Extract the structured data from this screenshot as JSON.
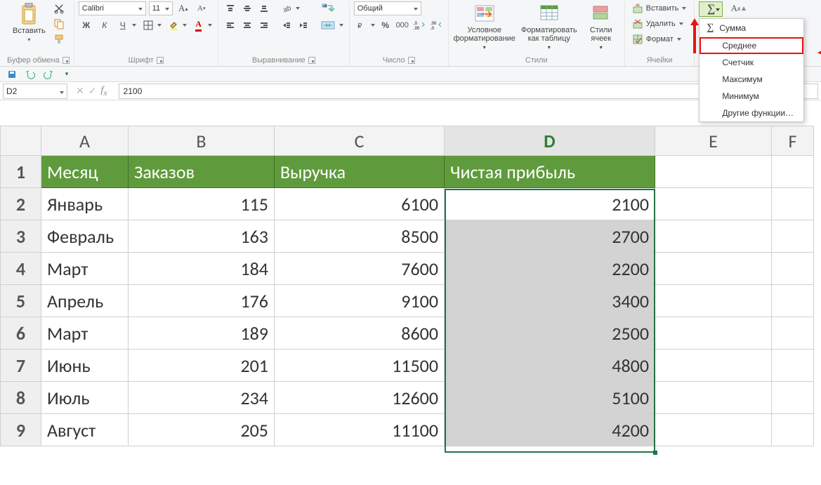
{
  "ribbon": {
    "clipboard": {
      "paste_label": "Вставить",
      "group_label": "Буфер обмена"
    },
    "font": {
      "family": "Calibri",
      "size": "11",
      "group_label": "Шрифт",
      "bold": "Ж",
      "italic": "К",
      "underline": "Ч"
    },
    "alignment": {
      "group_label": "Выравнивание"
    },
    "number": {
      "format": "Общий",
      "group_label": "Число"
    },
    "styles": {
      "cond_fmt": "Условное форматирование",
      "as_table": "Форматировать как таблицу",
      "cell_styles": "Стили ячеек",
      "group_label": "Стили"
    },
    "cells": {
      "insert": "Вставить",
      "delete": "Удалить",
      "format": "Формат",
      "group_label": "Ячейки"
    },
    "editing": {
      "autosum_menu": {
        "sum": "Сумма",
        "avg": "Среднее",
        "count": "Счетчик",
        "max": "Максимум",
        "min": "Минимум",
        "more": "Другие функции…"
      }
    }
  },
  "namebox": "D2",
  "formula": "2100",
  "columns": [
    "A",
    "B",
    "C",
    "D",
    "E",
    "F"
  ],
  "header_row": [
    "Месяц",
    "Заказов",
    "Выручка",
    "Чистая прибыль"
  ],
  "rows": [
    {
      "n": "2",
      "a": "Январь",
      "b": "115",
      "c": "6100",
      "d": "2100"
    },
    {
      "n": "3",
      "a": "Февраль",
      "b": "163",
      "c": "8500",
      "d": "2700"
    },
    {
      "n": "4",
      "a": "Март",
      "b": "184",
      "c": "7600",
      "d": "2200"
    },
    {
      "n": "5",
      "a": "Апрель",
      "b": "176",
      "c": "9100",
      "d": "3400"
    },
    {
      "n": "6",
      "a": "Март",
      "b": "189",
      "c": "8600",
      "d": "2500"
    },
    {
      "n": "7",
      "a": "Июнь",
      "b": "201",
      "c": "11500",
      "d": "4800"
    },
    {
      "n": "8",
      "a": "Июль",
      "b": "234",
      "c": "12600",
      "d": "5100"
    },
    {
      "n": "9",
      "a": "Август",
      "b": "205",
      "c": "11100",
      "d": "4200"
    }
  ],
  "chart_data": {
    "type": "table",
    "columns": [
      "Месяц",
      "Заказов",
      "Выручка",
      "Чистая прибыль"
    ],
    "rows": [
      [
        "Январь",
        115,
        6100,
        2100
      ],
      [
        "Февраль",
        163,
        8500,
        2700
      ],
      [
        "Март",
        184,
        7600,
        2200
      ],
      [
        "Апрель",
        176,
        9100,
        3400
      ],
      [
        "Март",
        189,
        8600,
        2500
      ],
      [
        "Июнь",
        201,
        11500,
        4800
      ],
      [
        "Июль",
        234,
        12600,
        5100
      ],
      [
        "Август",
        205,
        11100,
        4200
      ]
    ]
  }
}
